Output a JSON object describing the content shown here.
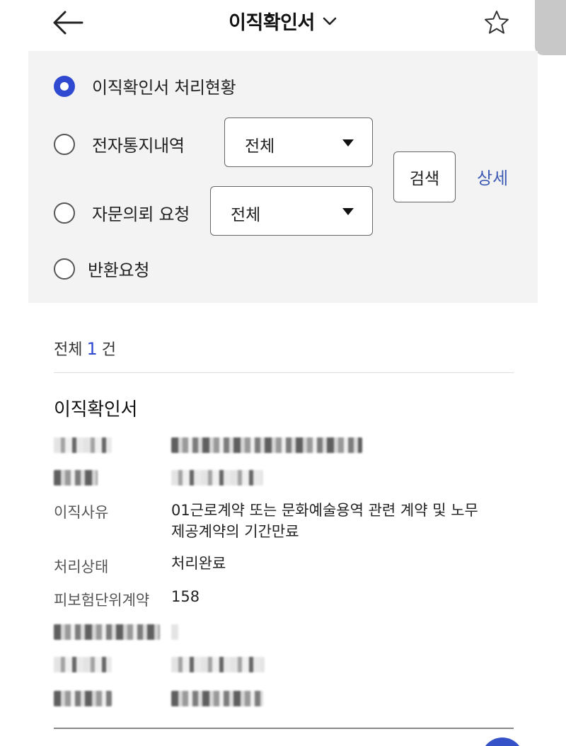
{
  "header": {
    "title": "이직확인서",
    "icons": {
      "back": "arrow-left-icon",
      "dropdown": "chevron-down-icon",
      "favorite": "star-outline-icon"
    }
  },
  "filter": {
    "options": [
      {
        "label": "이직확인서 처리현황",
        "checked": true
      },
      {
        "label": "전자통지내역",
        "checked": false,
        "select_value": "전체"
      },
      {
        "label": "자문의뢰 요청",
        "checked": false,
        "select_value": "전체"
      },
      {
        "label": "반환요청",
        "checked": false
      }
    ],
    "search_label": "검색",
    "detail_label": "상세"
  },
  "results": {
    "total_prefix": "전체",
    "total_count": "1",
    "total_suffix": "건",
    "item": {
      "title": "이직확인서",
      "fields": [
        {
          "label": "이직사유",
          "value_line1": "01근로계약 또는 문화예술용역 관련 계약 및 노무",
          "value_line2": "제공계약의 기간만료"
        },
        {
          "label": "처리상태",
          "value": "처리완료"
        },
        {
          "label": "피보험단위계약",
          "value": "158"
        }
      ]
    }
  },
  "colors": {
    "accent": "#2f4ad0",
    "link": "#3d5bb5",
    "panel_bg": "#f3f3f3"
  }
}
